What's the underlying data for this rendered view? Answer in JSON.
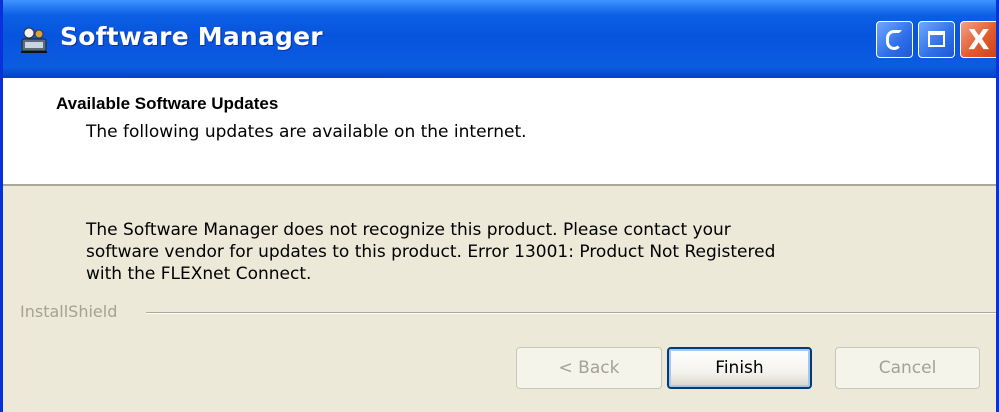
{
  "window": {
    "title": "Software Manager",
    "icon": "software-manager-app-icon",
    "controls": {
      "help_icon": "help-icon",
      "maximize_icon": "maximize-icon",
      "close_glyph": "X"
    }
  },
  "header": {
    "title": "Available Software Updates",
    "subtitle": "The following updates are available on the internet."
  },
  "body": {
    "message_line1": "The Software Manager does not recognize this product.  Please contact your",
    "message_line2": "software vendor for updates to this product. Error 13001: Product Not Registered",
    "message_line3": "with the FLEXnet Connect."
  },
  "branding": {
    "label": "InstallShield"
  },
  "buttons": {
    "back_label": "< Back",
    "finish_label": "Finish",
    "cancel_label": "Cancel"
  },
  "colors": {
    "titlebar_blue": "#0855dd",
    "dialog_background": "#ece9d8",
    "header_background": "#ffffff",
    "close_red": "#e35a2c",
    "disabled_text": "#a4a294"
  }
}
